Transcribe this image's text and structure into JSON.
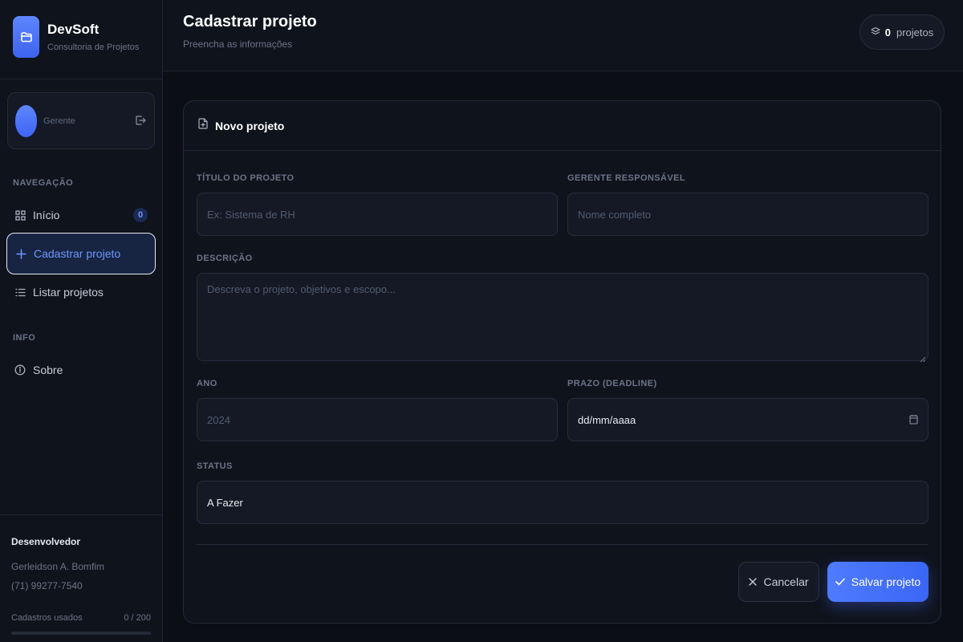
{
  "brand": {
    "name": "DevSoft",
    "subtitle": "Consultoria de Projetos"
  },
  "user": {
    "role": "Gerente"
  },
  "nav": {
    "section_label": "NAVEGAÇÃO",
    "items": [
      {
        "label": "Início",
        "badge": "0"
      },
      {
        "label": "Cadastrar projeto"
      },
      {
        "label": "Listar projetos"
      }
    ]
  },
  "info": {
    "section_label": "INFO",
    "items": [
      {
        "label": "Sobre"
      }
    ]
  },
  "developer": {
    "title": "Desenvolvedor",
    "name": "Gerleidson A. Bomfim",
    "phone": "(71) 99277-7540"
  },
  "usage": {
    "label": "Cadastros usados",
    "count_text": "0 / 200",
    "fraction": 0.0
  },
  "header": {
    "title": "Cadastrar projeto",
    "subtitle": "Preencha as informações",
    "count": "0",
    "count_label": "projetos"
  },
  "form": {
    "title": "Novo projeto",
    "project_title": {
      "label": "TÍTULO DO PROJETO",
      "placeholder": "Ex: Sistema de RH",
      "value": ""
    },
    "manager": {
      "label": "GERENTE RESPONSÁVEL",
      "placeholder": "Nome completo",
      "value": ""
    },
    "description": {
      "label": "DESCRIÇÃO",
      "placeholder": "Descreva o projeto, objetivos e escopo...",
      "value": ""
    },
    "year": {
      "label": "ANO",
      "placeholder": "2024",
      "value": ""
    },
    "deadline": {
      "label": "PRAZO (DEADLINE)",
      "value": "dd/mm/aaaa"
    },
    "status": {
      "label": "STATUS",
      "value": "A Fazer"
    },
    "cancel_label": "Cancelar",
    "save_label": "Salvar projeto"
  },
  "colors": {
    "accent": "#4f7bff",
    "background": "#0b0e15",
    "panel": "#0f131c"
  }
}
